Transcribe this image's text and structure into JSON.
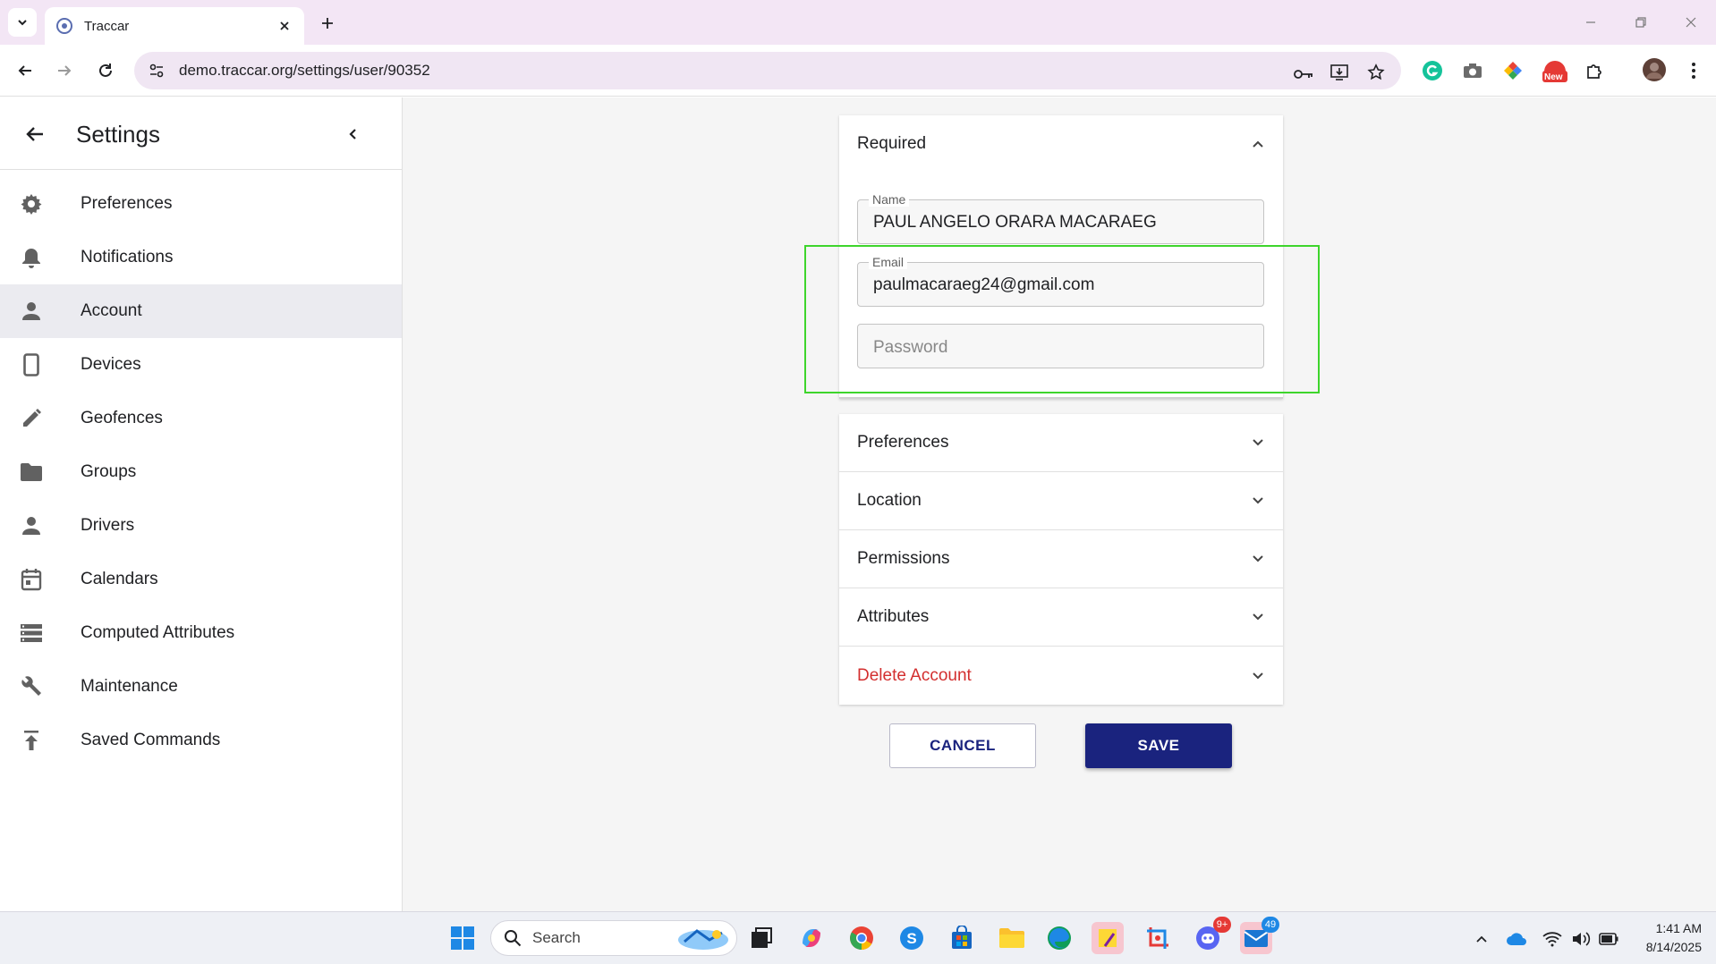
{
  "browser": {
    "tab_title": "Traccar",
    "url": "demo.traccar.org/settings/user/90352",
    "new_badge": "New"
  },
  "sidebar": {
    "title": "Settings",
    "items": [
      {
        "label": "Preferences",
        "icon": "gear-icon"
      },
      {
        "label": "Notifications",
        "icon": "bell-icon"
      },
      {
        "label": "Account",
        "icon": "person-icon",
        "active": true
      },
      {
        "label": "Devices",
        "icon": "phone-icon"
      },
      {
        "label": "Geofences",
        "icon": "pencil-icon"
      },
      {
        "label": "Groups",
        "icon": "folder-icon"
      },
      {
        "label": "Drivers",
        "icon": "person-icon"
      },
      {
        "label": "Calendars",
        "icon": "calendar-icon"
      },
      {
        "label": "Computed Attributes",
        "icon": "storage-icon"
      },
      {
        "label": "Maintenance",
        "icon": "wrench-icon"
      },
      {
        "label": "Saved Commands",
        "icon": "publish-icon"
      }
    ]
  },
  "form": {
    "required_title": "Required",
    "name": {
      "label": "Name",
      "value": "PAUL ANGELO ORARA MACARAEG"
    },
    "email": {
      "label": "Email",
      "value": "paulmacaraeg24@gmail.com"
    },
    "password": {
      "placeholder": "Password"
    },
    "sections": [
      "Preferences",
      "Location",
      "Permissions",
      "Attributes",
      "Delete Account"
    ],
    "cancel_label": "CANCEL",
    "save_label": "SAVE"
  },
  "taskbar": {
    "search_placeholder": "Search",
    "discord_badge": "9+",
    "mail_badge": "49",
    "time": "1:41 AM",
    "date": "8/14/2025"
  },
  "colors": {
    "primary": "#1a237e",
    "danger": "#d32f2f",
    "highlight": "#3ed52c"
  }
}
